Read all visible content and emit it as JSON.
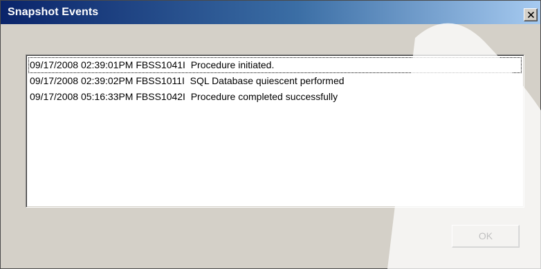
{
  "window": {
    "title": "Snapshot Events",
    "close_icon": "close-x-icon"
  },
  "events": [
    {
      "text": "09/17/2008 02:39:01PM FBSS1041I  Procedure initiated."
    },
    {
      "text": "09/17/2008 02:39:02PM FBSS1011I  SQL Database quiescent performed"
    },
    {
      "text": "09/17/2008 05:16:33PM FBSS1042I  Procedure completed successfully"
    }
  ],
  "buttons": {
    "ok_label": "OK"
  },
  "colors": {
    "titlebar_start": "#0a246a",
    "titlebar_end": "#a6caf0",
    "dialog_face": "#d4d0c8"
  }
}
